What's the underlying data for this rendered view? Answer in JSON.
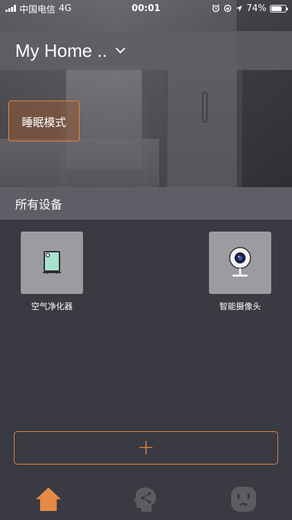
{
  "status_bar": {
    "carrier": "中国电信",
    "network": "4G",
    "time": "00:01",
    "battery_percent": "74%",
    "battery_level": 0.74
  },
  "header": {
    "home_name": "My Home ..",
    "dropdown_icon": "chevron-down-icon"
  },
  "scenes": [
    {
      "label": "睡眠模式"
    }
  ],
  "section": {
    "title": "所有设备"
  },
  "devices": [
    {
      "label": "空气净化器",
      "icon": "air-purifier-icon"
    },
    {
      "label": "智能摄像头",
      "icon": "camera-icon"
    }
  ],
  "add_button": {
    "label": "+"
  },
  "tabs": [
    {
      "name": "home",
      "icon": "home-icon",
      "active": true
    },
    {
      "name": "share",
      "icon": "head-share-icon",
      "active": false
    },
    {
      "name": "device",
      "icon": "outlet-icon",
      "active": false
    }
  ],
  "colors": {
    "accent": "#e58a45",
    "background": "#393a42",
    "tab_inactive": "#5c5d63"
  }
}
